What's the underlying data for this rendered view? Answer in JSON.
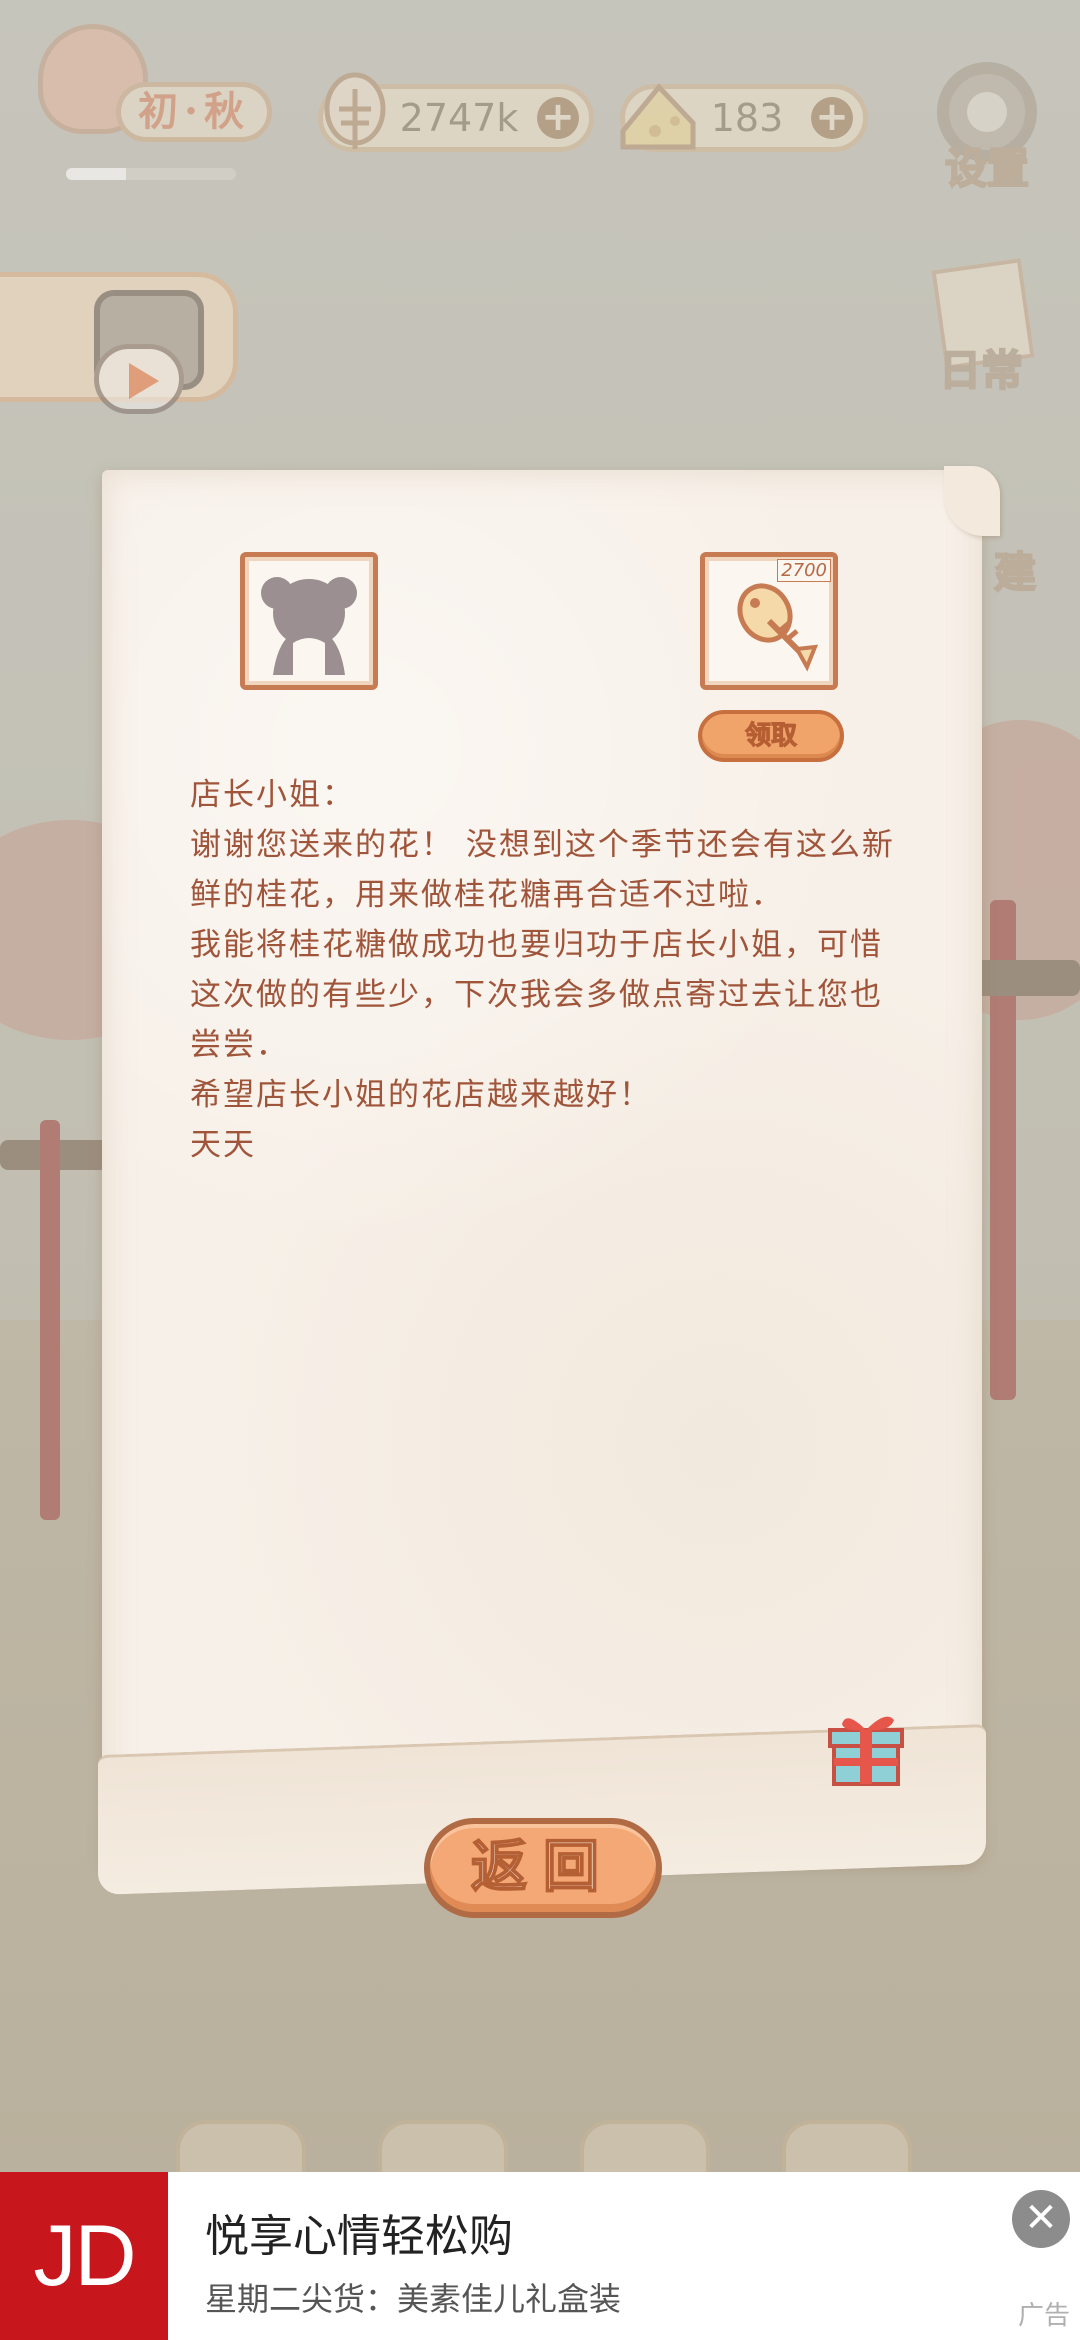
{
  "hud": {
    "season_label": "初·秋",
    "season_progress": 0.35,
    "fish_value": "2747k",
    "cheese_value": "183",
    "plus_symbol": "+",
    "settings_label": "设置",
    "daily_label": "日常",
    "build_label": "建"
  },
  "letter": {
    "reward_amount": "2700",
    "claim_label": "领取",
    "salutation": "店长小姐：",
    "paragraphs": [
      "谢谢您送来的花！ 没想到这个季节还会有这么新鲜的桂花，用来做桂花糖再合适不过啦．",
      "我能将桂花糖做成功也要归功于店长小姐，可惜这次做的有些少，下次我会多做点寄过去让您也尝尝．",
      "希望店长小姐的花店越来越好！"
    ],
    "signature": "天天",
    "return_label": "返回"
  },
  "ad": {
    "logo_text": "JD",
    "title": "悦享心情轻松购",
    "subtitle": "星期二尖货：美素佳儿礼盒装",
    "close_symbol": "✕",
    "tag": "广告"
  },
  "colors": {
    "letter_text": "#a0553a",
    "button_fill": "#f3a876",
    "ad_brand": "#c8161d"
  }
}
